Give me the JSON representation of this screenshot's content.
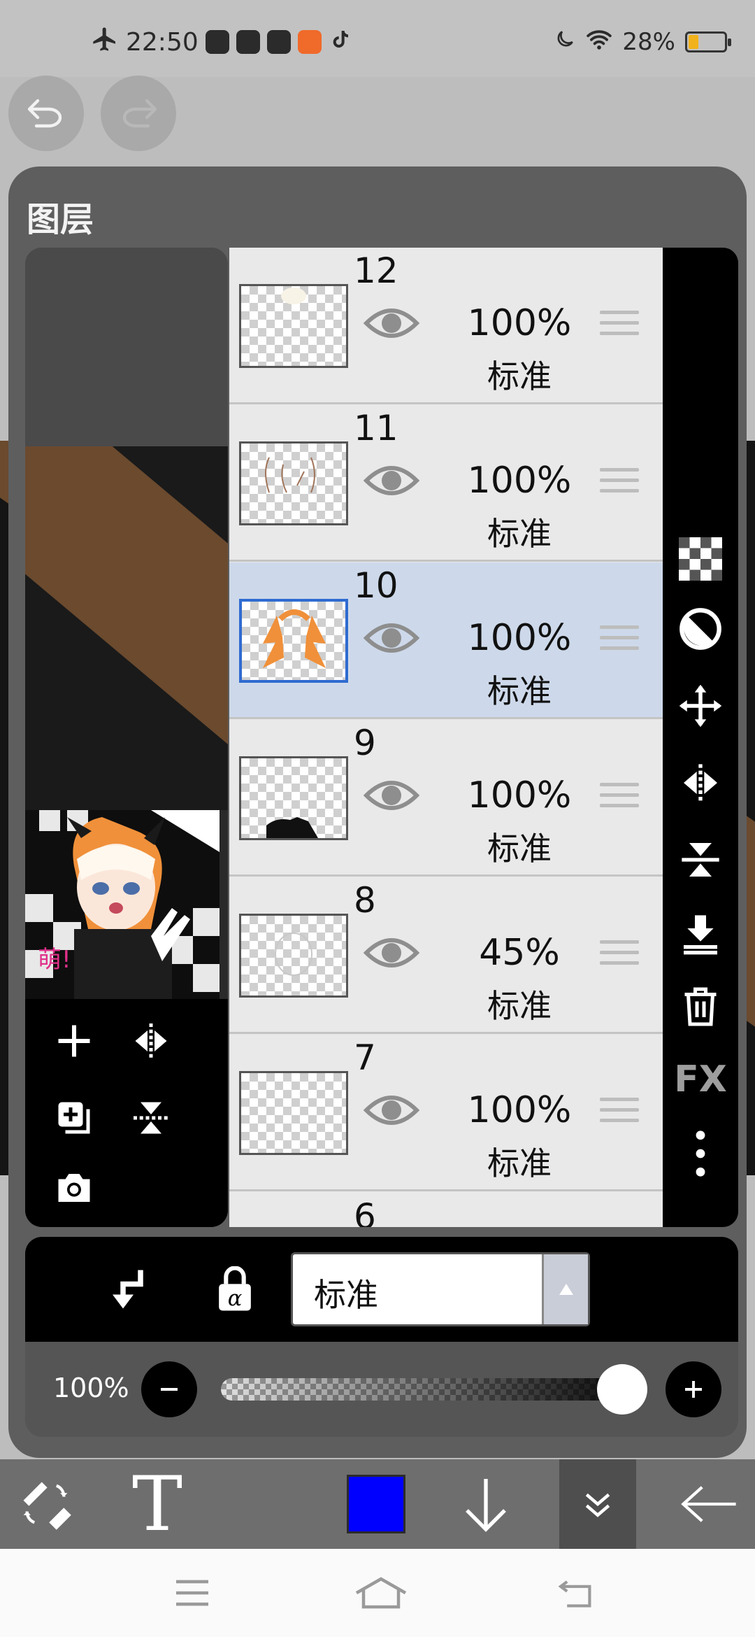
{
  "status_bar": {
    "time": "22:50",
    "battery": "28%",
    "battery_level": 0.28
  },
  "panel": {
    "title": "图层"
  },
  "layers": [
    {
      "number": "12",
      "opacity": "100%",
      "blend": "标准",
      "selected": false
    },
    {
      "number": "11",
      "opacity": "100%",
      "blend": "标准",
      "selected": false
    },
    {
      "number": "10",
      "opacity": "100%",
      "blend": "标准",
      "selected": true
    },
    {
      "number": "9",
      "opacity": "100%",
      "blend": "标准",
      "selected": false
    },
    {
      "number": "8",
      "opacity": "45%",
      "blend": "标准",
      "selected": false
    },
    {
      "number": "7",
      "opacity": "100%",
      "blend": "标准",
      "selected": false
    },
    {
      "number": "6",
      "opacity": "",
      "blend": "",
      "selected": false
    }
  ],
  "right_toolbar": {
    "fx_label": "FX"
  },
  "blend_mode": {
    "value": "标准"
  },
  "opacity_control": {
    "label": "100%",
    "value": 1.0
  },
  "toolbar": {
    "text_tool_label": "T",
    "current_color": "#0000ff"
  },
  "colors": {
    "panel_bg": "#5e5e5e",
    "selected_layer": "#cdd9ea",
    "selected_thumb_border": "#2f6bd0"
  }
}
